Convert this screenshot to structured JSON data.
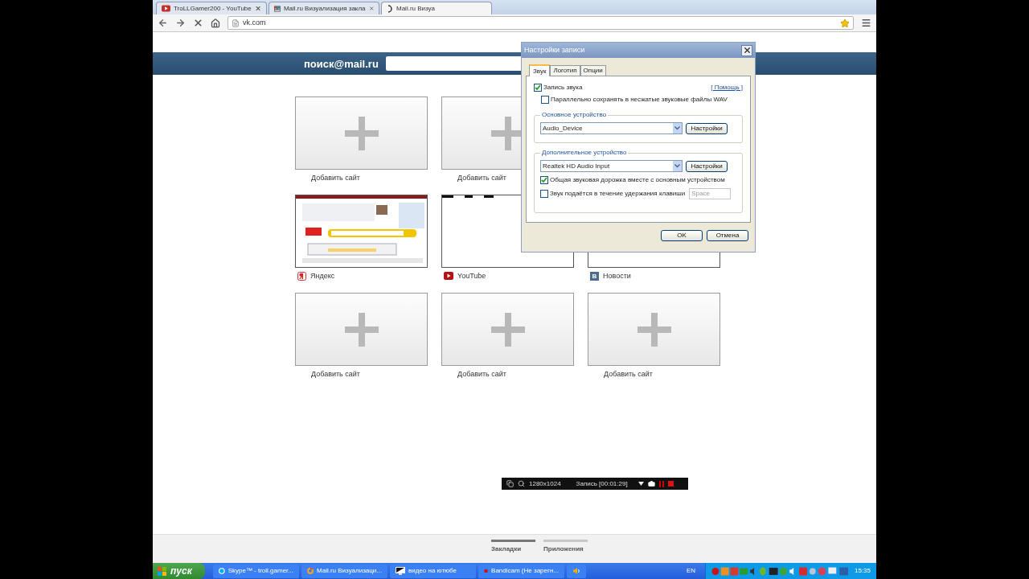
{
  "browser": {
    "tabs": [
      {
        "title": "TroLLGamer200 - YouTube",
        "selected": false
      },
      {
        "title": "Mail.ru Визуализация закла",
        "selected": false
      },
      {
        "title": "Mail.ru Визуа",
        "selected": true
      }
    ],
    "address": "vk.com"
  },
  "header": {
    "logo": "поиск@mail.ru"
  },
  "tiles": [
    {
      "kind": "add",
      "label": "Добавить сайт"
    },
    {
      "kind": "add",
      "label": "Добавить сайт"
    },
    {
      "kind": "picture",
      "label": "Яндекс"
    },
    {
      "kind": "blank",
      "label": "YouTube"
    },
    {
      "kind": "blank",
      "label": "Новости",
      "site_badge": "В"
    },
    {
      "kind": "add",
      "label": "Добавить сайт"
    },
    {
      "kind": "add",
      "label": "Добавить сайт"
    },
    {
      "kind": "add",
      "label": "Добавить сайт"
    }
  ],
  "dialog": {
    "title": "Настройки записи",
    "tabs": [
      {
        "label": "Звук",
        "selected": true
      },
      {
        "label": "Логотип",
        "selected": false
      },
      {
        "label": "Опции",
        "selected": false
      }
    ],
    "record_sound": {
      "label": "Запись звука",
      "checked": true
    },
    "help_link": "[ Помощь ]",
    "save_wav": {
      "label": "Параллельно сохранять в несжатые звуковые файлы WAV",
      "checked": false
    },
    "main_device": {
      "legend": "Основное устройство",
      "value": "Audio_Device",
      "button": "Настройки"
    },
    "extra_device": {
      "legend": "Дополнительное устройство",
      "value": "Realtek HD Audio Input",
      "button": "Настройки",
      "options": [
        {
          "label": "Общая звуковая дорожка вместе с основным устройством",
          "checked": true
        },
        {
          "label": "Звук подаётся в течение удержания клавиши",
          "checked": false
        }
      ],
      "hotkey": "Space"
    },
    "buttons": [
      "OK",
      "Отмена"
    ]
  },
  "recorder": {
    "resolution": "1280x1024",
    "status": "Запись [00:01:29]"
  },
  "bookmark_tabs": [
    {
      "label": "Закладки",
      "selected": true
    },
    {
      "label": "Приложения",
      "selected": false
    }
  ],
  "taskbar": {
    "start": "пуск",
    "items": [
      {
        "label": "Skype™ - troll.gamer..."
      },
      {
        "label": "Mail.ru Визуализаци..."
      },
      {
        "label": "видео на ютюбе"
      },
      {
        "label": "Bandicam (Не зарегн..."
      }
    ],
    "language": "EN",
    "clock": "15:35"
  }
}
